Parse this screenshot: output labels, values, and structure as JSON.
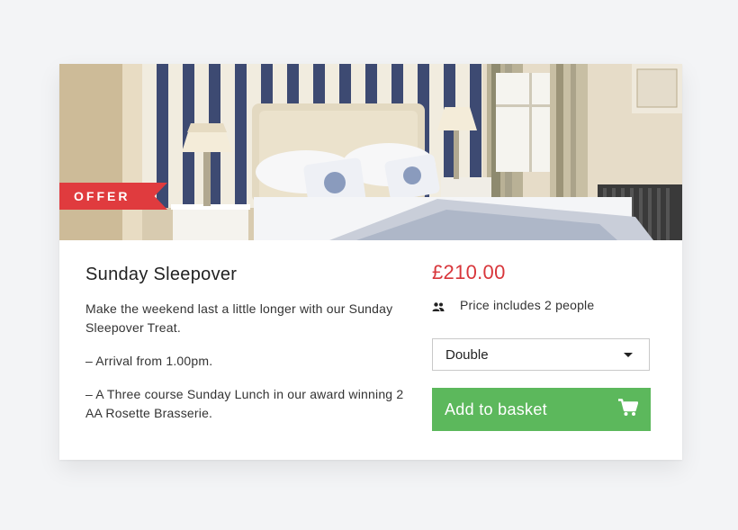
{
  "badge": {
    "label": "OFFER"
  },
  "product": {
    "title": "Sunday Sleepover",
    "description": [
      "Make the weekend last a little longer with our Sunday Sleepover Treat.",
      "– Arrival from 1.00pm.",
      "– A Three course Sunday Lunch in our award winning 2 AA Rosette Brasserie."
    ],
    "price": "£210.00",
    "price_note": "Price includes 2 people",
    "room_select": {
      "selected": "Double"
    },
    "add_button_label": "Add to basket"
  },
  "icons": {
    "people": "people-icon",
    "dropdown": "chevron-down-icon",
    "cart": "shopping-cart-icon"
  },
  "colors": {
    "offer": "#e03b3e",
    "price": "#d8363b",
    "button": "#5cb85c"
  }
}
